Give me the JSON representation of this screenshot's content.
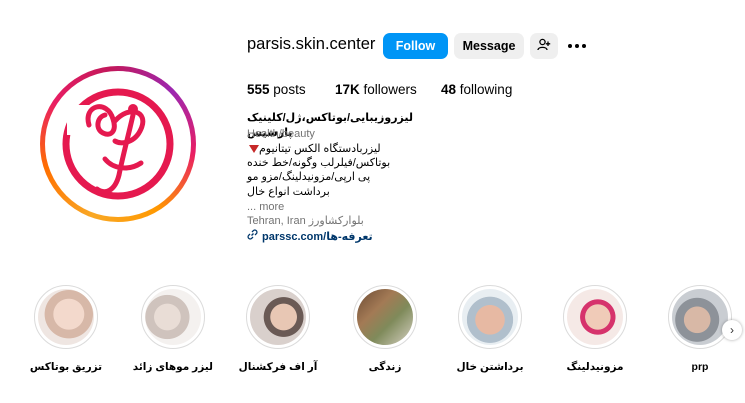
{
  "profile": {
    "username": "parsis.skin.center",
    "follow_label": "Follow",
    "message_label": "Message",
    "add_user_icon": "add-user-icon",
    "more_icon": "more-options-icon"
  },
  "stats": {
    "posts_count": "555",
    "posts_label": "posts",
    "followers_count": "17K",
    "followers_label": "followers",
    "following_count": "48",
    "following_label": "following"
  },
  "bio": {
    "name": "لیزروزیبایی/بوتاکس،ژل/کلینیک پارسیس",
    "category": "Health/beauty",
    "lines": [
      "لیزربادستگاه الکس تیتانیوم",
      "بوتاکس/فیلرلب وگونه/خط خنده",
      "پی ارپی/مزونیدلینگ/مزو مو",
      "برداشت انواع خال"
    ],
    "more": "... more",
    "location": "Tehran, Iran بلوارکشاورز",
    "link_text": "parssc.com/تعرفه-ها"
  },
  "highlights": [
    {
      "label": "تزریق بوتاکس"
    },
    {
      "label": "لیزر موهای زائد"
    },
    {
      "label": "آر اف فرکشنال"
    },
    {
      "label": "زندگی"
    },
    {
      "label": "برداشتن خال"
    },
    {
      "label": "مزونیدلینگ"
    },
    {
      "label": "prp"
    }
  ],
  "colors": {
    "accent": "#0095f6",
    "brand": "#e91e63"
  }
}
